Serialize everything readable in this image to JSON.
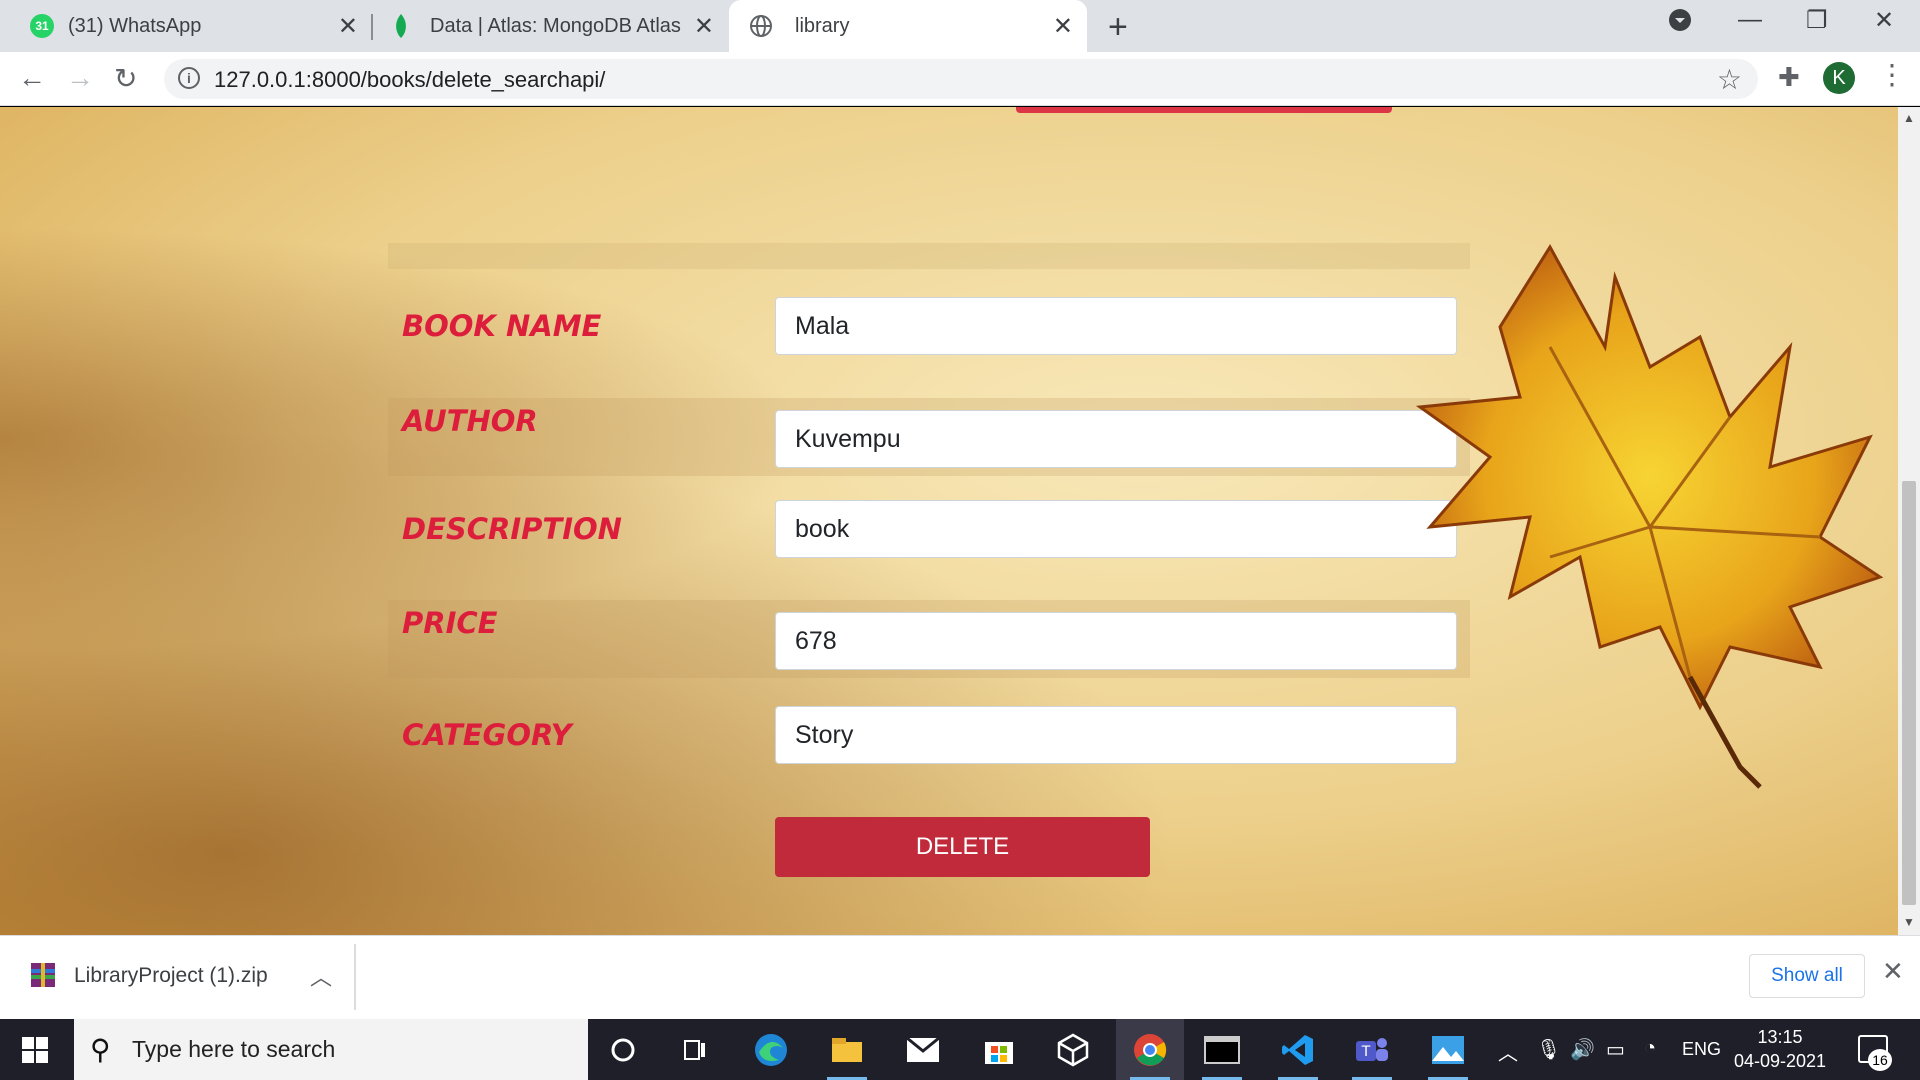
{
  "browser": {
    "tabs": [
      {
        "title": "(31) WhatsApp",
        "favicon_badge": "31",
        "favicon_color": "#25d366",
        "active": false
      },
      {
        "title": "Data | Atlas: MongoDB Atlas",
        "favicon_color": "#13aa52",
        "active": false
      },
      {
        "title": "library",
        "favicon_color": "#5f6368",
        "active": true
      }
    ],
    "url": "127.0.0.1:8000/books/delete_searchapi/",
    "profile_initial": "K"
  },
  "form": {
    "fields": [
      {
        "label": "BOOK NAME",
        "value": "Mala"
      },
      {
        "label": "AUTHOR",
        "value": "Kuvempu"
      },
      {
        "label": "DESCRIPTION",
        "value": "book"
      },
      {
        "label": "PRICE",
        "value": "678"
      },
      {
        "label": "CATEGORY",
        "value": "Story"
      }
    ],
    "delete_label": "DELETE",
    "label_color": "#dc1e3c",
    "button_color": "#c12a3b"
  },
  "downloads": {
    "file_name": "LibraryProject (1).zip",
    "show_all_label": "Show all"
  },
  "taskbar": {
    "search_placeholder": "Type here to search",
    "language": "ENG",
    "time": "13:15",
    "date": "04-09-2021",
    "notification_count": "16"
  }
}
